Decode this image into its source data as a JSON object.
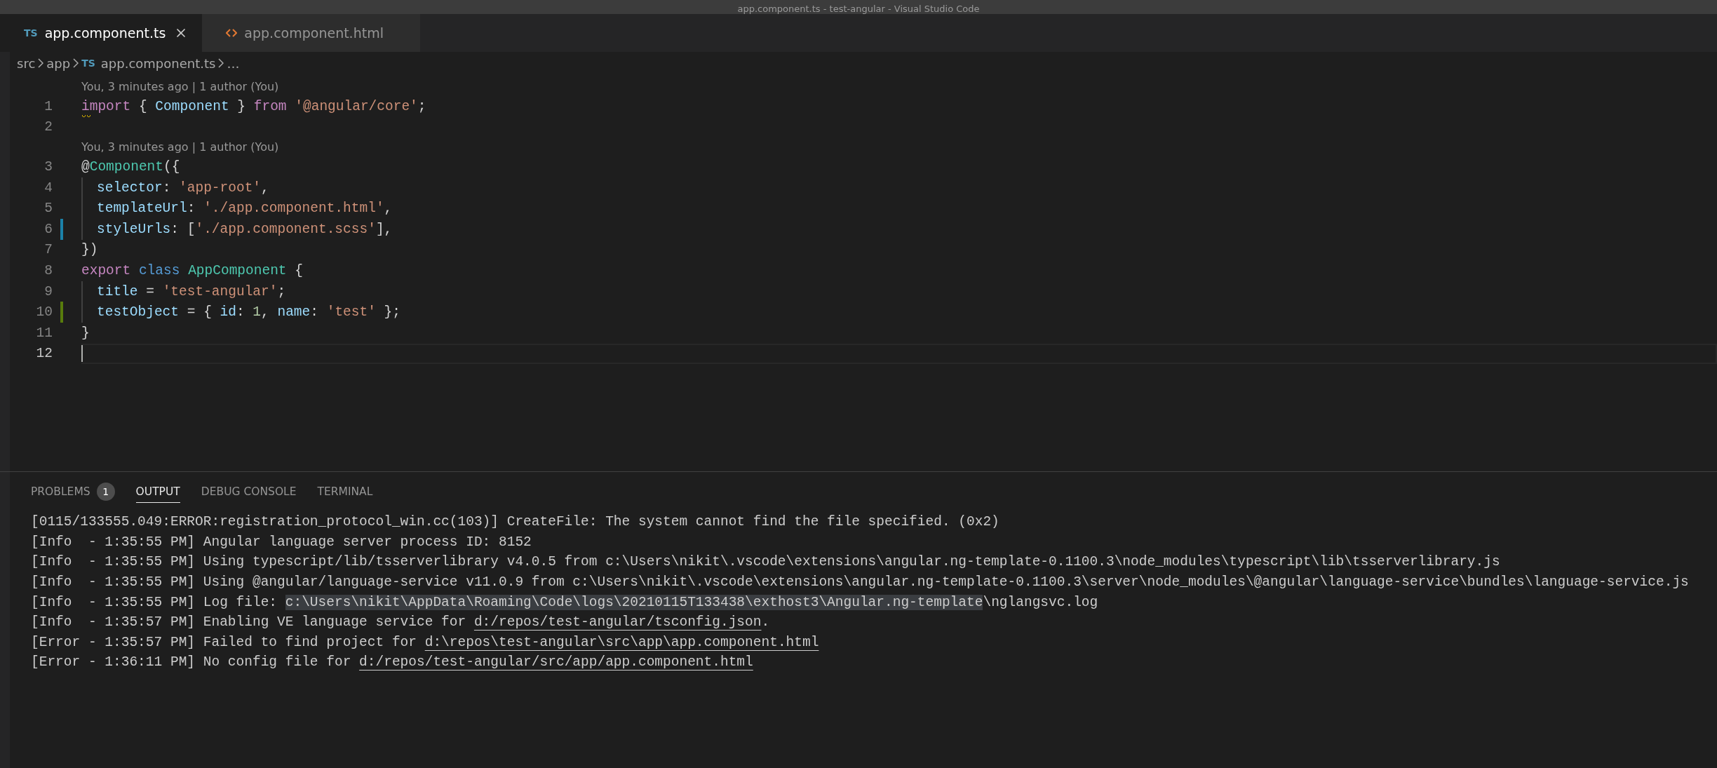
{
  "window": {
    "title": "app.component.ts - test-angular - Visual Studio Code"
  },
  "tabs": [
    {
      "icon": "TS",
      "kind": "ts",
      "label": "app.component.ts",
      "selected": true
    },
    {
      "kind": "html",
      "label": "app.component.html",
      "selected": false
    }
  ],
  "breadcrumbs": [
    {
      "label": "src"
    },
    {
      "label": "app"
    },
    {
      "icon": "TS",
      "label": "app.component.ts"
    },
    {
      "label": "…"
    }
  ],
  "editor": {
    "lines": [
      {
        "number": "1",
        "kind": "unchanged",
        "codelens": "You, 3 minutes ago | 1 author (You)",
        "warning": true,
        "indented": false,
        "current": false,
        "tokens": [
          {
            "kind": "control",
            "text": "import"
          },
          {
            "kind": "punct",
            "text": " { "
          },
          {
            "kind": "variable",
            "text": "Component"
          },
          {
            "kind": "punct",
            "text": " } "
          },
          {
            "kind": "control",
            "text": "from "
          },
          {
            "kind": "string",
            "text": "'@angular/core'"
          },
          {
            "kind": "punct",
            "text": ";"
          }
        ]
      },
      {
        "number": "2",
        "kind": "unchanged",
        "warning": false,
        "indented": false,
        "current": false
      },
      {
        "number": "3",
        "kind": "unchanged",
        "codelens": "You, 3 minutes ago | 1 author (You)",
        "warning": false,
        "indented": false,
        "current": false,
        "tokens": [
          {
            "kind": "punct",
            "text": "@"
          },
          {
            "kind": "type",
            "text": "Component"
          },
          {
            "kind": "punct",
            "text": "({"
          }
        ]
      },
      {
        "number": "4",
        "kind": "unchanged",
        "warning": false,
        "indented": true,
        "current": false,
        "tokens": [
          {
            "kind": "variable",
            "text": "selector"
          },
          {
            "kind": "punct",
            "text": ": "
          },
          {
            "kind": "string",
            "text": "'app-root'"
          },
          {
            "kind": "punct",
            "text": ","
          }
        ]
      },
      {
        "number": "5",
        "kind": "unchanged",
        "warning": false,
        "indented": true,
        "current": false,
        "tokens": [
          {
            "kind": "variable",
            "text": "templateUrl"
          },
          {
            "kind": "punct",
            "text": ": "
          },
          {
            "kind": "string",
            "text": "'./app.component.html'"
          },
          {
            "kind": "punct",
            "text": ","
          }
        ]
      },
      {
        "number": "6",
        "kind": "modified",
        "warning": false,
        "indented": true,
        "current": false,
        "tokens": [
          {
            "kind": "variable",
            "text": "styleUrls"
          },
          {
            "kind": "punct",
            "text": ": ["
          },
          {
            "kind": "string",
            "text": "'./app.component.scss'"
          },
          {
            "kind": "punct",
            "text": "],"
          }
        ]
      },
      {
        "number": "7",
        "kind": "unchanged",
        "warning": false,
        "indented": false,
        "current": false,
        "tokens": [
          {
            "kind": "punct",
            "text": "})"
          }
        ]
      },
      {
        "number": "8",
        "kind": "unchanged",
        "warning": false,
        "indented": false,
        "current": false,
        "tokens": [
          {
            "kind": "control",
            "text": "export "
          },
          {
            "kind": "storage",
            "text": "class "
          },
          {
            "kind": "type",
            "text": "AppComponent"
          },
          {
            "kind": "punct",
            "text": " {"
          }
        ]
      },
      {
        "number": "9",
        "kind": "unchanged",
        "warning": false,
        "indented": true,
        "current": false,
        "tokens": [
          {
            "kind": "variable",
            "text": "title"
          },
          {
            "kind": "punct",
            "text": " = "
          },
          {
            "kind": "string",
            "text": "'test-angular'"
          },
          {
            "kind": "punct",
            "text": ";"
          }
        ]
      },
      {
        "number": "10",
        "kind": "added",
        "warning": false,
        "indented": true,
        "current": false,
        "tokens": [
          {
            "kind": "variable",
            "text": "testObject"
          },
          {
            "kind": "punct",
            "text": " = { "
          },
          {
            "kind": "variable",
            "text": "id"
          },
          {
            "kind": "punct",
            "text": ": "
          },
          {
            "kind": "number",
            "text": "1"
          },
          {
            "kind": "punct",
            "text": ", "
          },
          {
            "kind": "variable",
            "text": "name"
          },
          {
            "kind": "punct",
            "text": ": "
          },
          {
            "kind": "string",
            "text": "'test'"
          },
          {
            "kind": "punct",
            "text": " };"
          }
        ]
      },
      {
        "number": "11",
        "kind": "unchanged",
        "warning": false,
        "indented": false,
        "current": false,
        "tokens": [
          {
            "kind": "punct",
            "text": "}"
          }
        ]
      },
      {
        "number": "12",
        "kind": "unchanged",
        "warning": false,
        "indented": false,
        "current": true
      }
    ]
  },
  "panel": {
    "tabs": [
      {
        "label": "PROBLEMS",
        "badge": "1",
        "selected": false
      },
      {
        "label": "OUTPUT",
        "selected": true
      },
      {
        "label": "DEBUG CONSOLE",
        "selected": false
      },
      {
        "label": "TERMINAL",
        "selected": false
      }
    ],
    "output": [
      {
        "segments": [
          {
            "kind": "plain",
            "text": "[0115/133555.049:ERROR:registration_protocol_win.cc(103)] CreateFile: The system cannot find the file specified. (0x2)"
          }
        ]
      },
      {
        "segments": [
          {
            "kind": "plain",
            "text": "[Info  - 1:35:55 PM] Angular language server process ID: 8152"
          }
        ]
      },
      {
        "segments": [
          {
            "kind": "plain",
            "text": "[Info  - 1:35:55 PM] Using typescript/lib/tsserverlibrary v4.0.5 from c:\\Users\\nikit\\.vscode\\extensions\\angular.ng-template-0.1100.3\\node_modules\\typescript\\lib\\tsserverlibrary.js"
          }
        ]
      },
      {
        "segments": [
          {
            "kind": "plain",
            "text": "[Info  - 1:35:55 PM] Using @angular/language-service v11.0.9 from c:\\Users\\nikit\\.vscode\\extensions\\angular.ng-template-0.1100.3\\server\\node_modules\\@angular\\language-service\\bundles\\language-service.js"
          }
        ]
      },
      {
        "segments": [
          {
            "kind": "plain",
            "text": "[Info  - 1:35:55 PM] Log file: "
          },
          {
            "kind": "highlight",
            "text": "c:\\Users\\nikit\\AppData\\Roaming\\Code\\logs\\20210115T133438\\exthost3\\Angular.ng-template"
          },
          {
            "kind": "plain",
            "text": "\\nglangsvc.log"
          }
        ]
      },
      {
        "segments": [
          {
            "kind": "plain",
            "text": "[Info  - 1:35:57 PM] Enabling VE language service for "
          },
          {
            "kind": "link",
            "text": "d:/repos/test-angular/tsconfig.json"
          },
          {
            "kind": "plain",
            "text": "."
          }
        ]
      },
      {
        "segments": [
          {
            "kind": "plain",
            "text": "[Error - 1:35:57 PM] Failed to find project for "
          },
          {
            "kind": "link",
            "text": "d:\\repos\\test-angular\\src\\app\\app.component.html"
          }
        ]
      },
      {
        "segments": [
          {
            "kind": "plain",
            "text": "[Error - 1:36:11 PM] No config file for "
          },
          {
            "kind": "link",
            "text": "d:/repos/test-angular/src/app/app.component.html"
          }
        ]
      }
    ]
  }
}
